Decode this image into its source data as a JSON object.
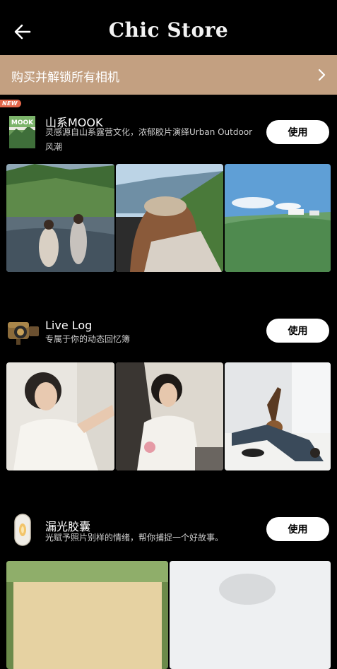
{
  "header": {
    "title": "Chic Store"
  },
  "banner": {
    "text": "购买并解锁所有相机"
  },
  "cameras": [
    {
      "badge": "NEW",
      "icon_label": "MOOK",
      "name": "山系MOOK",
      "desc": "灵感源自山系露营文化，浓郁胶片演绎Urban Outdoor风潮",
      "button": "使用"
    },
    {
      "name": "Live Log",
      "desc": "专属于你的动态回忆簿",
      "button": "使用"
    },
    {
      "name": "漏光胶囊",
      "desc": "光赋予照片别样的情绪，帮你捕捉一个好故事。",
      "button": "使用"
    }
  ],
  "icons": [
    "back-arrow-icon",
    "chevron-right-icon",
    "mook-camera-icon",
    "video-camera-icon",
    "light-capsule-icon"
  ],
  "colors": {
    "background": "#000000",
    "banner": "#c3a081",
    "badge": "#e2664a",
    "button_bg": "#ffffff"
  }
}
